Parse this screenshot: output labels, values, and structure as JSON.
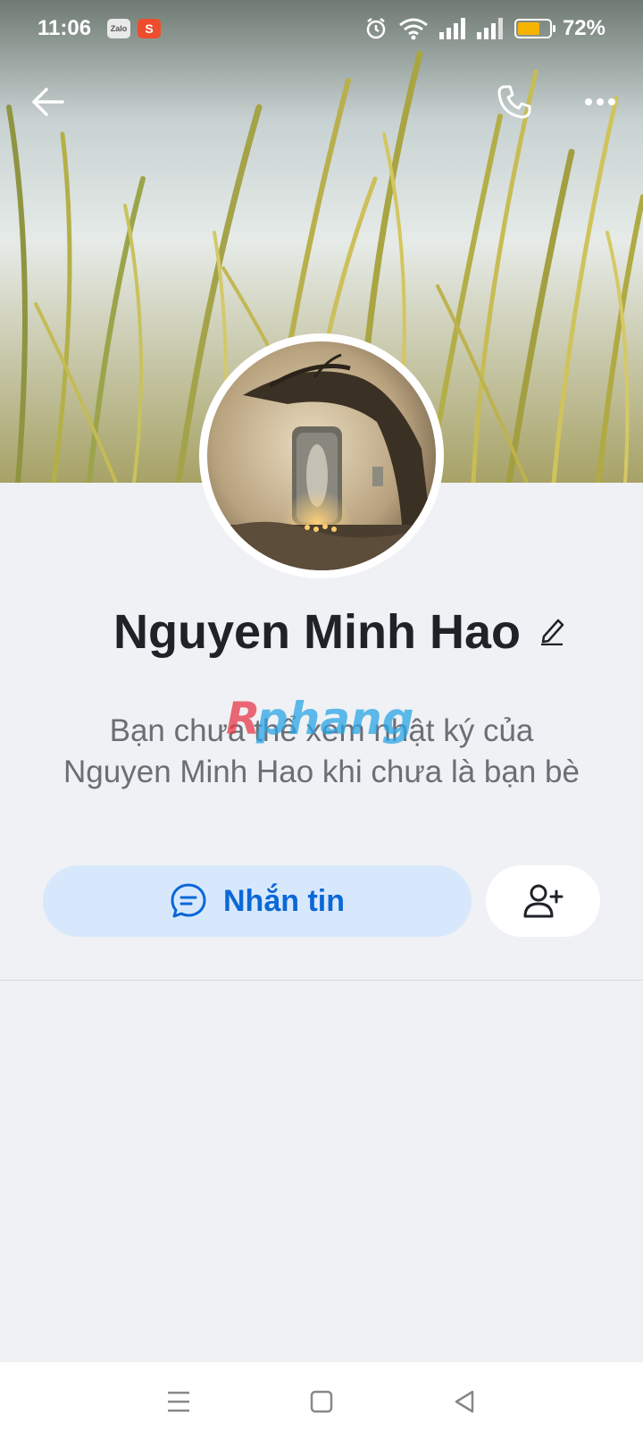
{
  "status_bar": {
    "time": "11:06",
    "zalo_label": "Zalo",
    "shopee_label": "S",
    "battery_percent": "72%",
    "battery_level": 0.72,
    "icons": [
      "alarm-icon",
      "wifi-icon",
      "signal-icon",
      "signal-icon",
      "battery-icon"
    ]
  },
  "profile": {
    "name": "Nguyen Minh Hao",
    "info_text": "Bạn chưa thể xem nhật ký của Nguyen Minh Hao khi chưa là bạn bè",
    "watermark": "Rphang"
  },
  "actions": {
    "message_label": "Nhắn tin",
    "message_icon": "chat-bubble-icon",
    "add_friend_icon": "add-user-icon"
  },
  "nav": {
    "back_icon": "arrow-left-icon",
    "call_icon": "phone-icon",
    "more_icon": "more-dots-icon"
  },
  "colors": {
    "accent": "#0a68d8",
    "message_button_bg": "#d8e8fc",
    "page_bg": "#eff1f4",
    "battery_fill": "#f5b400"
  }
}
